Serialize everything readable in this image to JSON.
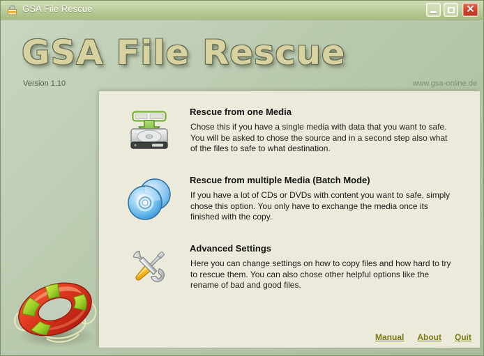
{
  "window": {
    "title": "GSA File Rescue",
    "icon": "padlock-icon",
    "controls": {
      "minimize": "_",
      "maximize": "□",
      "close": "✕"
    }
  },
  "banner": {
    "logo_text": "GSA File Rescue",
    "version": "Version 1.10",
    "url": "www.gsa-online.de",
    "decoration_icon": "lifering-icon"
  },
  "panel": {
    "options": [
      {
        "icon": "harddisk-download-icon",
        "title": "Rescue from one Media",
        "description": "Chose this if you have a single media with data that you want to safe. You will be asked to chose the source and in a second step also what of the files to safe to what destination."
      },
      {
        "icon": "compact-discs-icon",
        "title": "Rescue from multiple Media (Batch Mode)",
        "description": "If you have a lot of CDs or DVDs with content you want to safe, simply chose this option. You only have to exchange the media once its finished with the copy."
      },
      {
        "icon": "wrench-screwdriver-icon",
        "title": "Advanced Settings",
        "description": "Here you can change settings on how to copy files and how hard to try to rescue them. You can also chose other helpful options like the rename of bad and good files."
      }
    ],
    "footer_links": [
      {
        "label": "Manual"
      },
      {
        "label": "About"
      },
      {
        "label": "Quit"
      }
    ]
  },
  "colors": {
    "window_background_top": "#c9d6c1",
    "window_background_bottom": "#a9bc9c",
    "titlebar": "#c3d2a4",
    "panel_background": "#eceadb",
    "logo_fill": "#d8d1a0",
    "logo_outline": "#5f6b52",
    "link": "#7c7a14",
    "close_button": "#d2402a"
  }
}
